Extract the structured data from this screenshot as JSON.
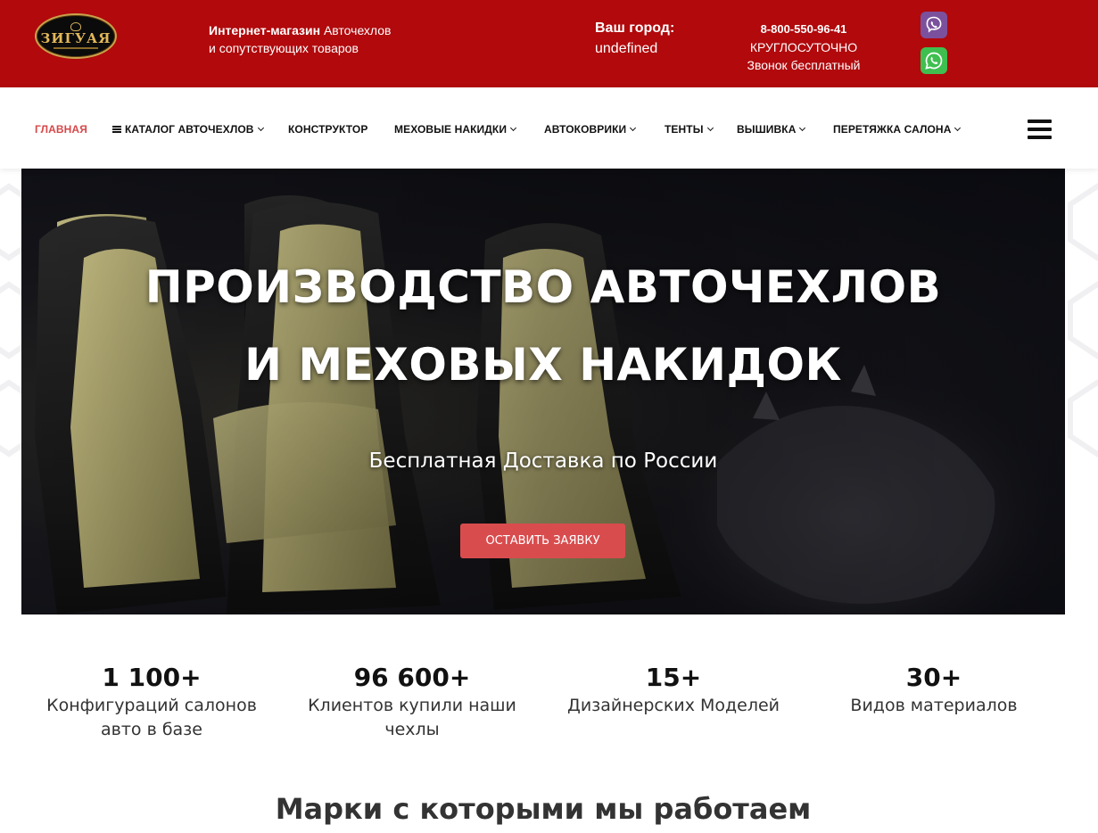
{
  "header": {
    "logo_text": "ЗИГУАЯ",
    "tagline_bold": "Интернет-магазин",
    "tagline_rest": " Авточехлов",
    "tagline_line2": "и сопутствующих товаров",
    "city_label": "Ваш город:",
    "city_value": "undefined",
    "phone": "8-800-550-96-41",
    "phone_hours": "КРУГЛОСУТОЧНО",
    "phone_note": "Звонок бесплатный",
    "messengers": [
      "viber-icon",
      "whatsapp-icon"
    ],
    "brand_color": "#b1090c"
  },
  "nav": {
    "items": [
      {
        "label": "ГЛАВНАЯ",
        "active": true,
        "dropdown": false
      },
      {
        "label": "КАТАЛОГ АВТОЧЕХЛОВ",
        "active": false,
        "dropdown": true,
        "icon": "list-icon"
      },
      {
        "label": "КОНСТРУКТОР",
        "active": false,
        "dropdown": false
      },
      {
        "label": "МЕХОВЫЕ НАКИДКИ",
        "active": false,
        "dropdown": true
      },
      {
        "label": "АВТОКОВРИКИ",
        "active": false,
        "dropdown": true
      },
      {
        "label": "ТЕНТЫ",
        "active": false,
        "dropdown": true
      },
      {
        "label": "ВЫШИВКА",
        "active": false,
        "dropdown": true
      },
      {
        "label": "ПЕРЕТЯЖКА САЛОНА",
        "active": false,
        "dropdown": true
      }
    ],
    "active_color": "#d7484a",
    "menu_icon": "hamburger-icon"
  },
  "hero": {
    "title_line1": "ПРОИЗВОДСТВО АВТОЧЕХЛОВ",
    "title_line2": "И МЕХОВЫХ НАКИДОК",
    "subtitle": "Бесплатная Доставка по России",
    "button_label": "ОСТАВИТЬ ЗАЯВКУ",
    "button_color": "#d94c4e"
  },
  "stats": [
    {
      "value": "1 100+",
      "label": "Конфигураций салонов авто в базе"
    },
    {
      "value": "96 600+",
      "label": "Клиентов купили наши чехлы"
    },
    {
      "value": "15+",
      "label": "Дизайнерских Моделей"
    },
    {
      "value": "30+",
      "label": "Видов материалов"
    }
  ],
  "brands_title": "Марки с которыми мы работаем"
}
